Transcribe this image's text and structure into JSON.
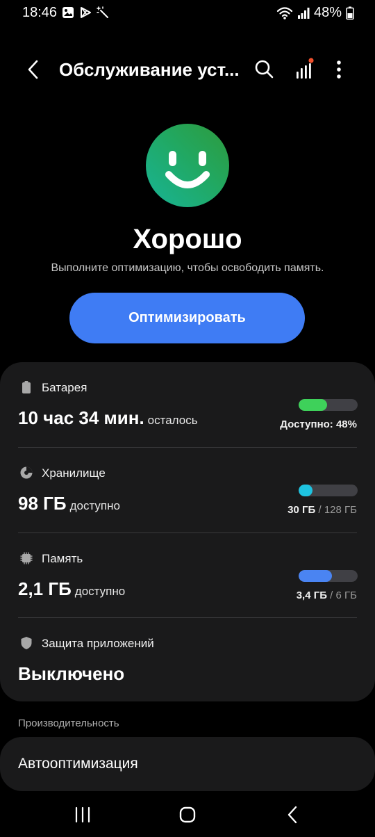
{
  "status_bar": {
    "time": "18:46",
    "battery": "48%",
    "icons_left": [
      "gallery-icon",
      "play-store-icon",
      "magic-wand-icon"
    ],
    "icons_right": [
      "wifi-icon",
      "signal-icon",
      "battery-icon"
    ]
  },
  "app_bar": {
    "title": "Обслуживание уст..."
  },
  "status": {
    "title": "Хорошо",
    "description": "Выполните оптимизацию, чтобы освободить память.",
    "face_colors": [
      "#2e9a3c",
      "#18b496"
    ]
  },
  "optimize_button": {
    "label": "Оптимизировать",
    "color": "#3f7cf4"
  },
  "battery": {
    "label": "Батарея",
    "value": "10 час 34 мин.",
    "suffix": "осталось",
    "caption": "Доступно: 48%",
    "fill": 0.48,
    "color": "#3ed15a"
  },
  "storage": {
    "label": "Хранилище",
    "value": "98 ГБ",
    "suffix": "доступно",
    "used": "30 ГБ",
    "separator": "/",
    "total": "128 ГБ",
    "fill": 0.234,
    "color": "#1ec3e0"
  },
  "memory": {
    "label": "Память",
    "value": "2,1 ГБ",
    "suffix": "доступно",
    "used": "3,4 ГБ",
    "separator": "/",
    "total": "6 ГБ",
    "fill": 0.567,
    "color": "#4a84f2"
  },
  "app_protection": {
    "label": "Защита приложений",
    "value": "Выключено"
  },
  "performance": {
    "header": "Производительность",
    "auto_optimization": "Автооптимизация"
  },
  "nav": {
    "items": [
      "recents-button",
      "home-button",
      "back-button"
    ]
  }
}
